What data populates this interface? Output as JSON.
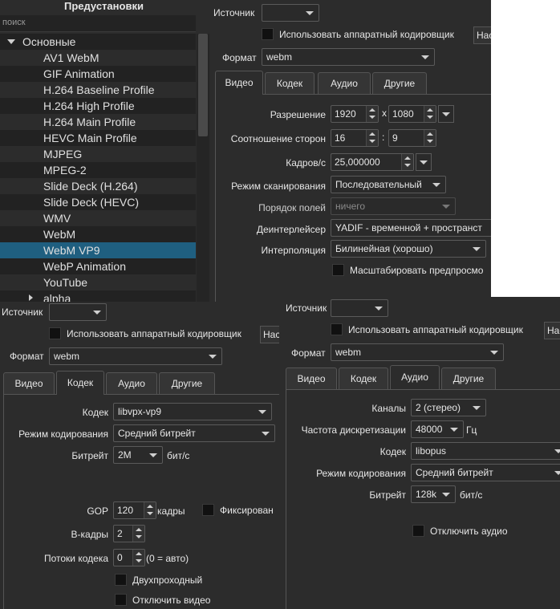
{
  "presets": {
    "title": "Предустановки",
    "search_placeholder": "поиск",
    "group_main": "Основные",
    "items": [
      "AV1 WebM",
      "GIF Animation",
      "H.264 Baseline Profile",
      "H.264 High Profile",
      "H.264 Main Profile",
      "HEVC Main Profile",
      "MJPEG",
      "MPEG-2",
      "Slide Deck (H.264)",
      "Slide Deck (HEVC)",
      "WMV",
      "WebM",
      "WebM VP9",
      "WebP Animation",
      "YouTube"
    ],
    "selected": "WebM VP9",
    "group_alpha": "alpha"
  },
  "video_window": {
    "source_label": "Источник",
    "hw_encoder_label": "Использовать аппаратный кодировщик",
    "hw_button": "Нас",
    "format_label": "Формат",
    "format_value": "webm",
    "tabs": [
      "Видео",
      "Кодек",
      "Аудио",
      "Другие"
    ],
    "resolution_label": "Разрешение",
    "res_w": "1920",
    "res_x": "x",
    "res_h": "1080",
    "aspect_label": "Соотношение сторон",
    "aspect_w": "16",
    "aspect_sep": ":",
    "aspect_h": "9",
    "fps_label": "Кадров/с",
    "fps_value": "25,000000",
    "scan_label": "Режим сканирования",
    "scan_value": "Последовательный",
    "field_order_label": "Порядок полей",
    "field_order_value": "ничего",
    "deinterlacer_label": "Деинтерлейсер",
    "deinterlacer_value": "YADIF - временной + пространст",
    "interpolation_label": "Интерполяция",
    "interpolation_value": "Билинейная (хорошо)",
    "scale_preview_label": "Масштабировать предпросмо"
  },
  "codec_window": {
    "source_label": "Источник",
    "hw_encoder_label": "Использовать аппаратный кодировщик",
    "hw_button": "Нас",
    "format_label": "Формат",
    "format_value": "webm",
    "tabs": [
      "Видео",
      "Кодек",
      "Аудио",
      "Другие"
    ],
    "codec_label": "Кодек",
    "codec_value": "libvpx-vp9",
    "rate_mode_label": "Режим кодирования",
    "rate_mode_value": "Средний битрейт",
    "bitrate_label": "Битрейт",
    "bitrate_value": "2M",
    "bitrate_unit": "бит/с",
    "gop_label": "GOP",
    "gop_value": "120",
    "gop_unit": "кадры",
    "fixed_label": "Фиксирован",
    "bframes_label": "B-кадры",
    "bframes_value": "2",
    "threads_label": "Потоки кодека",
    "threads_value": "0",
    "threads_hint": "(0 = авто)",
    "two_pass_label": "Двухпроходный",
    "disable_video_label": "Отключить видео"
  },
  "audio_window": {
    "source_label": "Источник",
    "hw_encoder_label": "Использовать аппаратный кодировщик",
    "hw_button": "Нас",
    "format_label": "Формат",
    "format_value": "webm",
    "tabs": [
      "Видео",
      "Кодек",
      "Аудио",
      "Другие"
    ],
    "channels_label": "Каналы",
    "channels_value": "2 (стерео)",
    "sample_rate_label": "Частота дискретизации",
    "sample_rate_value": "48000",
    "sample_rate_unit": "Гц",
    "codec_label": "Кодек",
    "codec_value": "libopus",
    "rate_mode_label": "Режим кодирования",
    "rate_mode_value": "Средний битрейт",
    "bitrate_label": "Битрейт",
    "bitrate_value": "128k",
    "bitrate_unit": "бит/с",
    "disable_audio_label": "Отключить аудио"
  }
}
